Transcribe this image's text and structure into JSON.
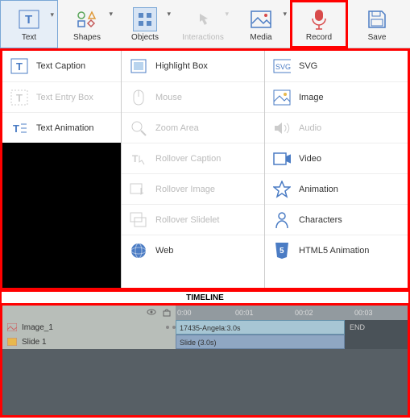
{
  "toolbar": {
    "text": "Text",
    "shapes": "Shapes",
    "objects": "Objects",
    "interactions": "Interactions",
    "media": "Media",
    "record": "Record",
    "save": "Save"
  },
  "menu": {
    "text_col": {
      "caption": "Text Caption",
      "entry": "Text Entry Box",
      "animation": "Text Animation"
    },
    "objects_col": {
      "highlight": "Highlight Box",
      "mouse": "Mouse",
      "zoom": "Zoom Area",
      "rollover_caption": "Rollover Caption",
      "rollover_image": "Rollover Image",
      "rollover_slidelet": "Rollover Slidelet",
      "web": "Web"
    },
    "media_col": {
      "svg": "SVG",
      "image": "Image",
      "audio": "Audio",
      "video": "Video",
      "animation": "Animation",
      "characters": "Characters",
      "html5": "HTML5 Animation"
    }
  },
  "timeline": {
    "label": "TIMELINE",
    "header_eye": "◉",
    "header_lock": "⬚",
    "ticks": [
      "0:00",
      "00:01",
      "00:02",
      "00:03"
    ],
    "row1": {
      "name": "Image_1",
      "clip": "17435-Angela:3.0s",
      "end": "END"
    },
    "row2": {
      "name": "Slide 1",
      "clip": "Slide (3.0s)"
    }
  }
}
